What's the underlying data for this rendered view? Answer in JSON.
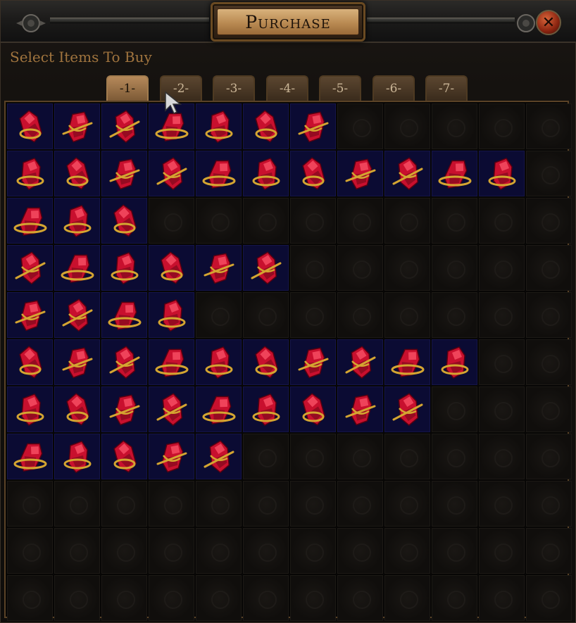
{
  "window": {
    "title": "Purchase",
    "close_label": "✕",
    "subtitle": "Select Items To Buy"
  },
  "tabs": [
    {
      "label": "-1-",
      "active": true
    },
    {
      "label": "-2-",
      "active": false
    },
    {
      "label": "-3-",
      "active": false
    },
    {
      "label": "-4-",
      "active": false
    },
    {
      "label": "-5-",
      "active": false
    },
    {
      "label": "-6-",
      "active": false
    },
    {
      "label": "-7-",
      "active": false
    }
  ],
  "grid": {
    "columns": 12,
    "rows": 11,
    "row_fill": [
      7,
      11,
      3,
      6,
      4,
      10,
      9,
      5,
      0,
      0,
      0
    ],
    "item_icon": "red-gem-with-gold-setting-icon",
    "colors": {
      "filled_bg": "#0b0b33",
      "gem": "#c8102e",
      "gold": "#d4a531"
    }
  }
}
